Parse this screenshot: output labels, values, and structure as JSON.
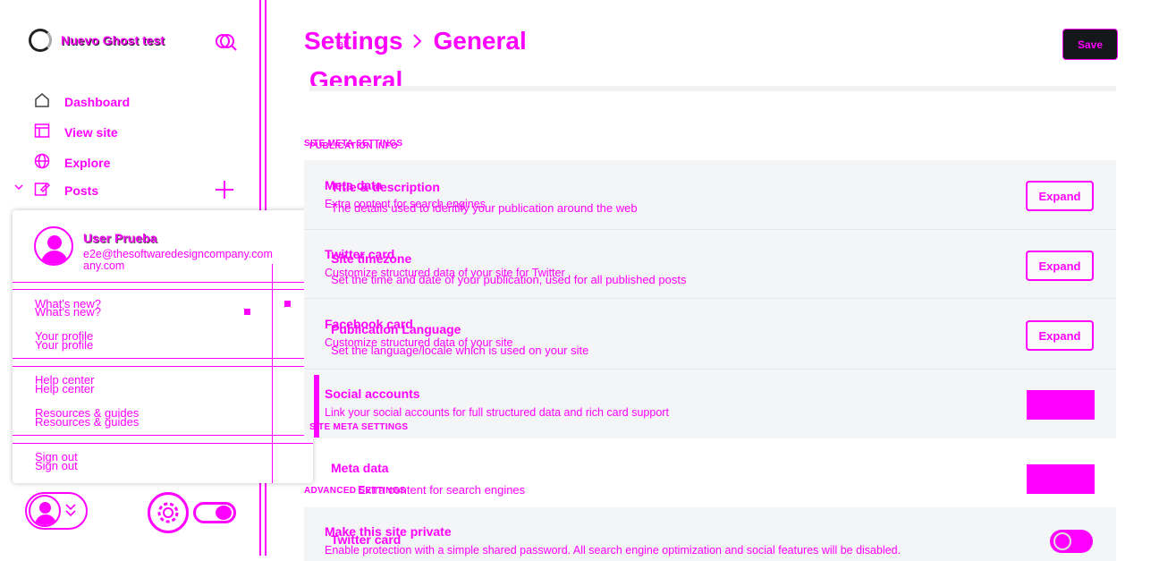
{
  "app": {
    "site_name": "Nuevo Ghost test"
  },
  "nav": {
    "items": [
      {
        "label": "Dashboard",
        "icon": "home-icon"
      },
      {
        "label": "View site",
        "icon": "browser-icon"
      },
      {
        "label": "Explore",
        "icon": "globe-icon"
      },
      {
        "label": "Posts",
        "icon": "edit-icon"
      }
    ]
  },
  "user_menu": {
    "name": "User Prueba",
    "email": "e2e@thesoftwaredesigncompany.com",
    "email_wrap": "any.com",
    "items": {
      "whats_new": "What's new?",
      "profile": "Your profile",
      "help": "Help center",
      "resources": "Resources & guides",
      "signout": "Sign out"
    }
  },
  "header": {
    "breadcrumb_root": "Settings",
    "breadcrumb_current": "General",
    "breadcrumb_sub": "al",
    "page_title": "General",
    "save_label": "Save"
  },
  "sections": {
    "publication_info": "PUBLICATION INFO",
    "site_meta": "SITE META SETTINGS",
    "site_meta_overlay": "SITE META SETTINGS",
    "advanced": "ADVANCED SETTINGS"
  },
  "rows": [
    {
      "title": "Title & description",
      "desc": "The details used to identify your publication around the web",
      "button": "Expand"
    },
    {
      "title": "Site timezone",
      "desc": "Set the time and date of your publication, used for all published posts",
      "button": "Expand"
    },
    {
      "title": "Publication Language",
      "desc": "Set the language/locale which is used on your site",
      "button": "Expand"
    }
  ],
  "overlay_rows": [
    {
      "title": "Meta data",
      "desc": "Extra content for search engines"
    },
    {
      "title": "Twitter card",
      "desc": "Customize structured data of your site for Twitter"
    },
    {
      "title": "Facebook card",
      "desc": "Customize structured data of your site"
    },
    {
      "title": "Social accounts",
      "desc": "Link your social accounts for full structured data and rich card support"
    }
  ],
  "meta_section": {
    "title": "Meta data",
    "desc": "Extra content for search engines"
  },
  "advanced_row": {
    "title": "Make this site private",
    "subtitle": "Twitter card",
    "desc": "Enable protection with a simple shared password. All search engine optimization and social features will be disabled."
  },
  "colors": {
    "accent": "#ff00ff",
    "dark": "#15171a",
    "panel": "#f4f5f6"
  }
}
